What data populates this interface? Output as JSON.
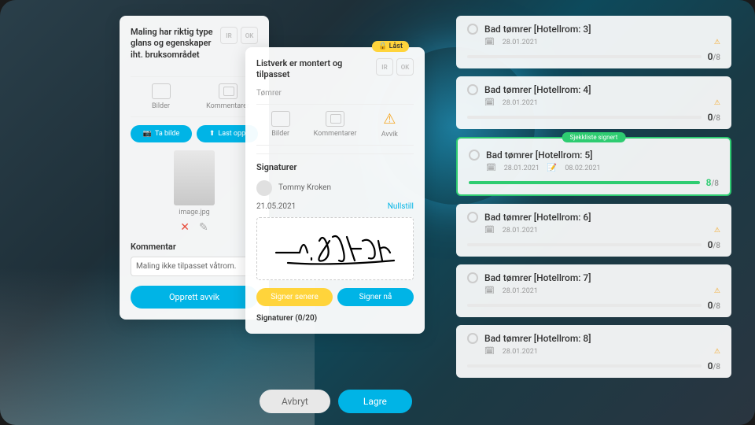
{
  "left_card": {
    "title": "Maling har riktig type glans og egenskaper iht. bruksområdet",
    "tabs": {
      "bilder": "Bilder",
      "kommentarer": "Kommentarer"
    },
    "ta_bilde": "Ta bilde",
    "last_opp": "Last opp",
    "thumb_label": "image.jpg",
    "kommentar_label": "Kommentar",
    "kommentar_value": "Maling ikke tilpasset våtrom.",
    "opprett_avvik": "Opprett avvik",
    "ir": "IR",
    "ok": "OK"
  },
  "mid_card": {
    "locked": "Låst",
    "title": "Listverk er montert og tilpasset",
    "role": "Tømrer",
    "ir": "IR",
    "ok": "OK",
    "tabs": {
      "bilder": "Bilder",
      "kommentarer": "Kommentarer",
      "avvik": "Avvik"
    },
    "signaturer": "Signaturer",
    "signer_name": "Tommy Kroken",
    "sig_date": "21.05.2021",
    "nullstill": "Nullstill",
    "signer_senere": "Signer senere",
    "signer_na": "Signer nå",
    "sig_count": "Signaturer (0/20)"
  },
  "bottom": {
    "avbryt": "Avbryt",
    "lagre": "Lagre"
  },
  "list": [
    {
      "title": "Bad tømrer [Hotellrom: 3]",
      "date": "28.01.2021",
      "done": 0,
      "total": 8,
      "progress": 0,
      "signed": false
    },
    {
      "title": "Bad tømrer [Hotellrom: 4]",
      "date": "28.01.2021",
      "done": 0,
      "total": 8,
      "progress": 0,
      "signed": false
    },
    {
      "title": "Bad tømrer [Hotellrom: 5]",
      "date": "28.01.2021",
      "edit_date": "08.02.2021",
      "done": 8,
      "total": 8,
      "progress": 100,
      "signed": true,
      "signed_label": "Sjekkliste signert"
    },
    {
      "title": "Bad tømrer [Hotellrom: 6]",
      "date": "28.01.2021",
      "done": 0,
      "total": 8,
      "progress": 0,
      "signed": false
    },
    {
      "title": "Bad tømrer [Hotellrom: 7]",
      "date": "28.01.2021",
      "done": 0,
      "total": 8,
      "progress": 0,
      "signed": false
    },
    {
      "title": "Bad tømrer [Hotellrom: 8]",
      "date": "28.01.2021",
      "done": 0,
      "total": 8,
      "progress": 0,
      "signed": false
    }
  ]
}
